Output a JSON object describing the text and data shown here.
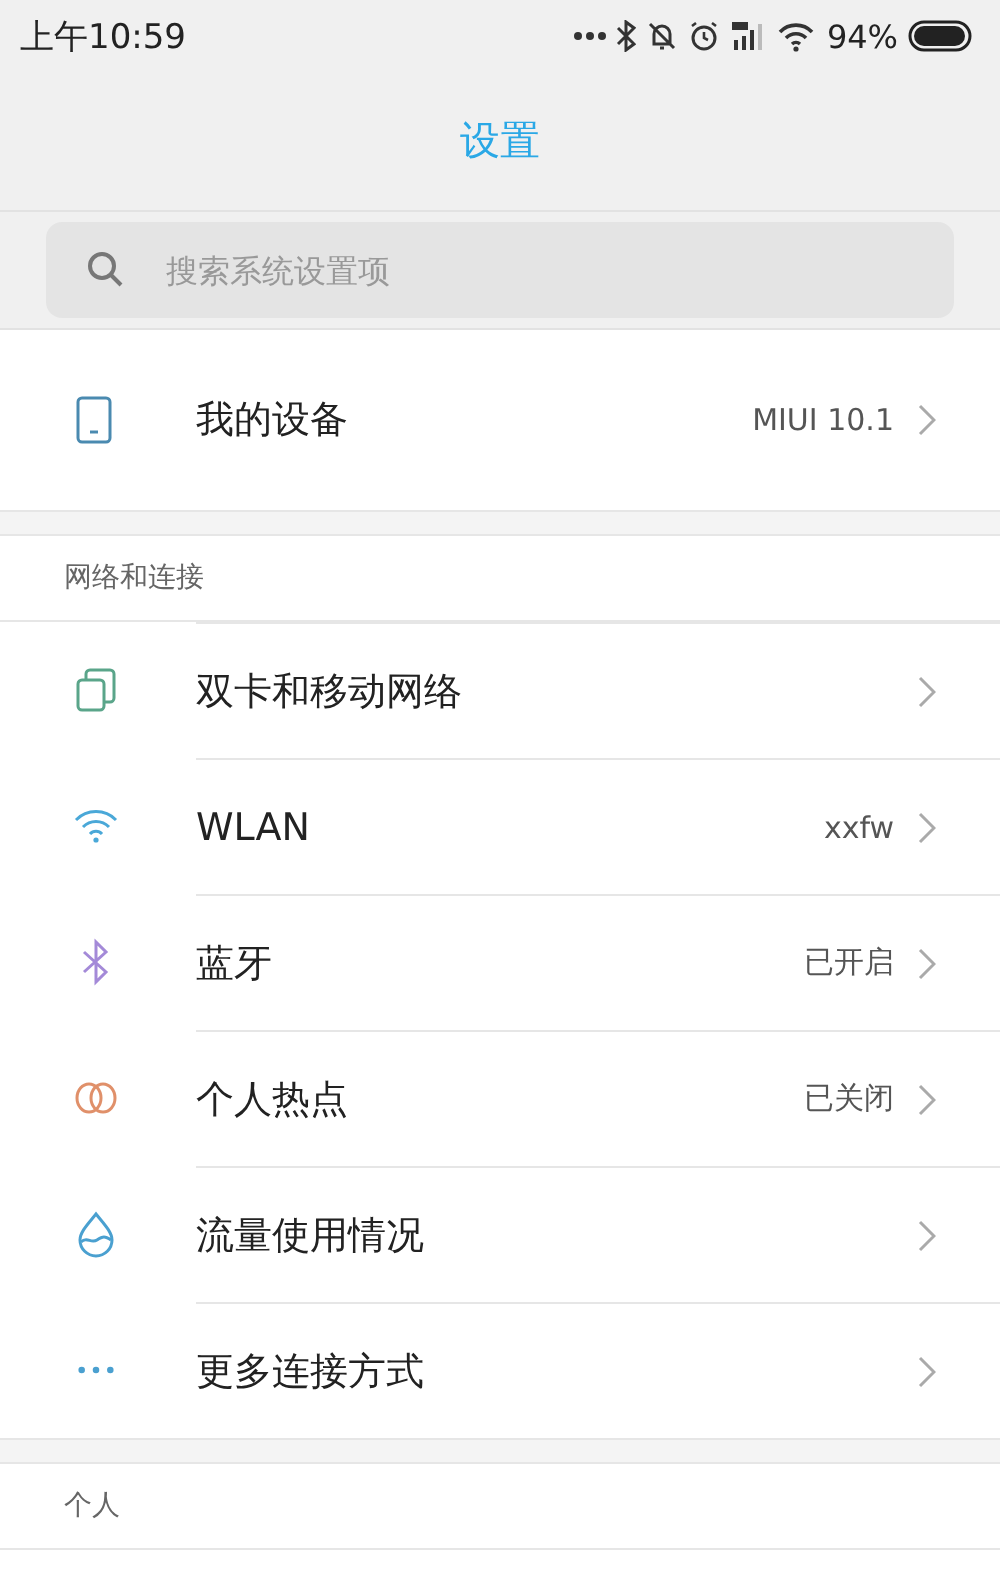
{
  "status_bar": {
    "time": "上午10:59",
    "battery": "94%"
  },
  "title": "设置",
  "search": {
    "placeholder": "搜索系统设置项"
  },
  "device": {
    "label": "我的设备",
    "value": "MIUI 10.1"
  },
  "sections": [
    {
      "header": "网络和连接",
      "items": [
        {
          "kind": "sim",
          "label": "双卡和移动网络"
        },
        {
          "kind": "wifi",
          "label": "WLAN",
          "value": "xxfw"
        },
        {
          "kind": "bluetooth",
          "label": "蓝牙",
          "value": "已开启"
        },
        {
          "kind": "hotspot",
          "label": "个人热点",
          "value": "已关闭"
        },
        {
          "kind": "data",
          "label": "流量使用情况"
        },
        {
          "kind": "more",
          "label": "更多连接方式"
        }
      ]
    },
    {
      "header": "个人"
    }
  ]
}
